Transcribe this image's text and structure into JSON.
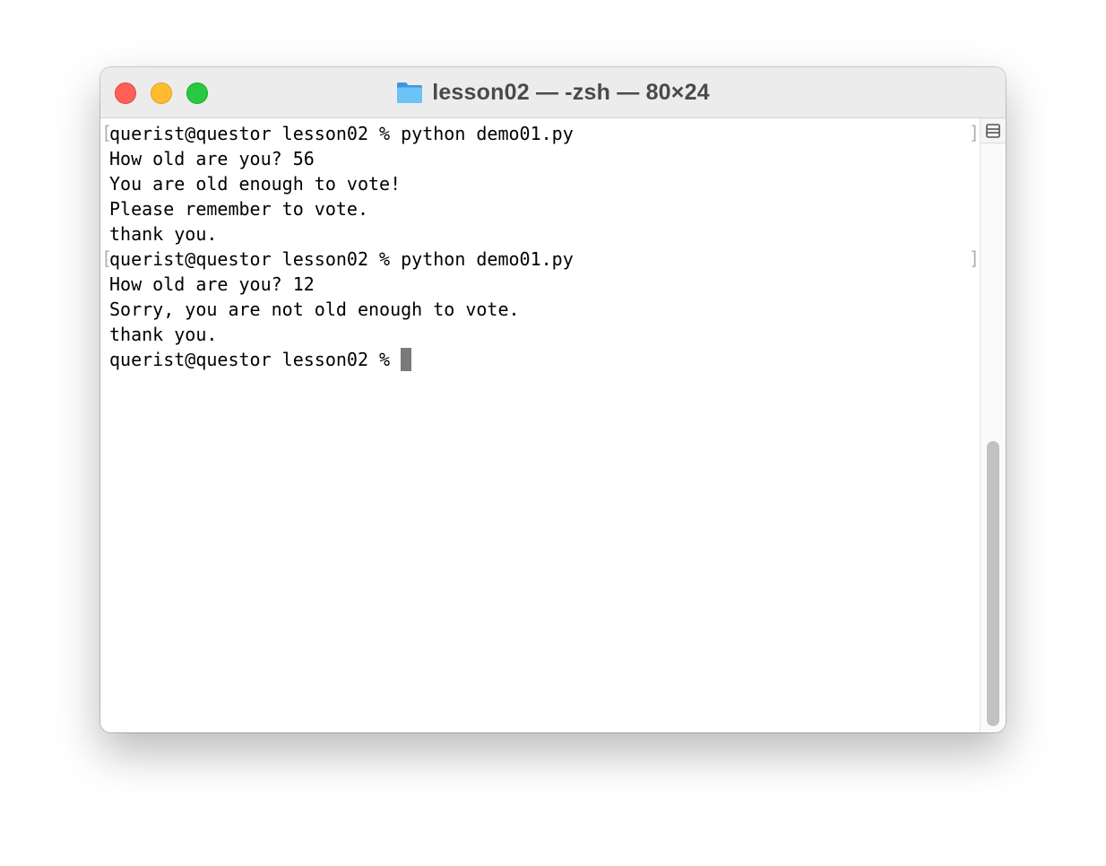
{
  "window": {
    "title": "lesson02 — -zsh — 80×24"
  },
  "terminal": {
    "lines": [
      "querist@questor lesson02 % python demo01.py",
      "How old are you? 56",
      "You are old enough to vote!",
      "Please remember to vote.",
      "thank you.",
      "querist@questor lesson02 % python demo01.py",
      "How old are you? 12",
      "Sorry, you are not old enough to vote.",
      "thank you.",
      "querist@questor lesson02 % "
    ]
  },
  "icons": {
    "title_icon": "folder-icon",
    "split": "split-pane-icon"
  },
  "colors": {
    "close": "#ff5f57",
    "minimize": "#febc2e",
    "zoom": "#28c840",
    "folder": "#4aa8e8"
  }
}
